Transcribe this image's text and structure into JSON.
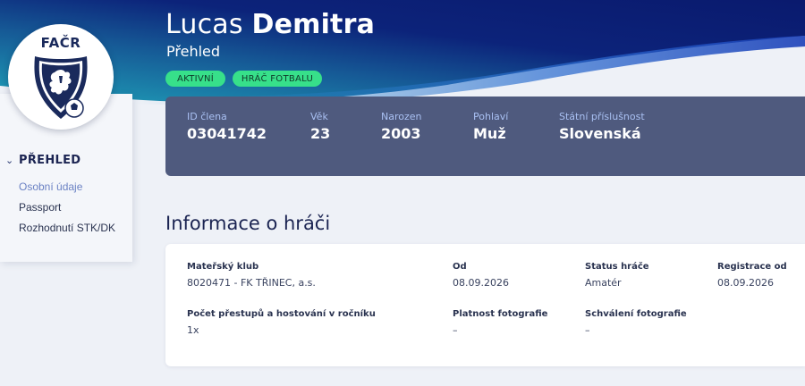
{
  "colors": {
    "hero_dark": "#0a1a6e",
    "hero_teal": "#1b8db0",
    "badge_green": "#37e08a",
    "member_card": "#4f5a7e",
    "label_blue": "#a9c0f2",
    "active_link": "#6b82c4"
  },
  "logo": {
    "text": "FAČR",
    "icon": "facr-crest-icon"
  },
  "sidebar": {
    "heading_icon": "chevron-down-icon",
    "heading": "PŘEHLED",
    "items": [
      {
        "label": "Osobní údaje",
        "active": true
      },
      {
        "label": "Passport",
        "active": false
      },
      {
        "label": "Rozhodnutí STK/DK",
        "active": false
      }
    ]
  },
  "header": {
    "first_name": "Lucas",
    "last_name": "Demitra",
    "subtitle": "Přehled",
    "badges": [
      "AKTIVNÍ",
      "HRÁČ FOTBALU"
    ]
  },
  "member": {
    "fields": [
      {
        "label": "ID člena",
        "value": "03041742"
      },
      {
        "label": "Věk",
        "value": "23"
      },
      {
        "label": "Narozen",
        "value": "2003"
      },
      {
        "label": "Pohlaví",
        "value": "Muž"
      },
      {
        "label": "Státní příslušnost",
        "value": "Slovenská"
      }
    ]
  },
  "player_info": {
    "title": "Informace o hráči",
    "fields": [
      {
        "label": "Mateřský klub",
        "value": "8020471 - FK TŘINEC, a.s."
      },
      {
        "label": "Od",
        "value": "08.09.2026"
      },
      {
        "label": "Status hráče",
        "value": "Amatér"
      },
      {
        "label": "Registrace od",
        "value": "08.09.2026"
      },
      {
        "label": "Počet přestupů a hostování v ročníku",
        "value": "1x"
      },
      {
        "label": "Platnost fotografie",
        "value": "–"
      },
      {
        "label": "Schválení fotografie",
        "value": "–"
      }
    ]
  }
}
